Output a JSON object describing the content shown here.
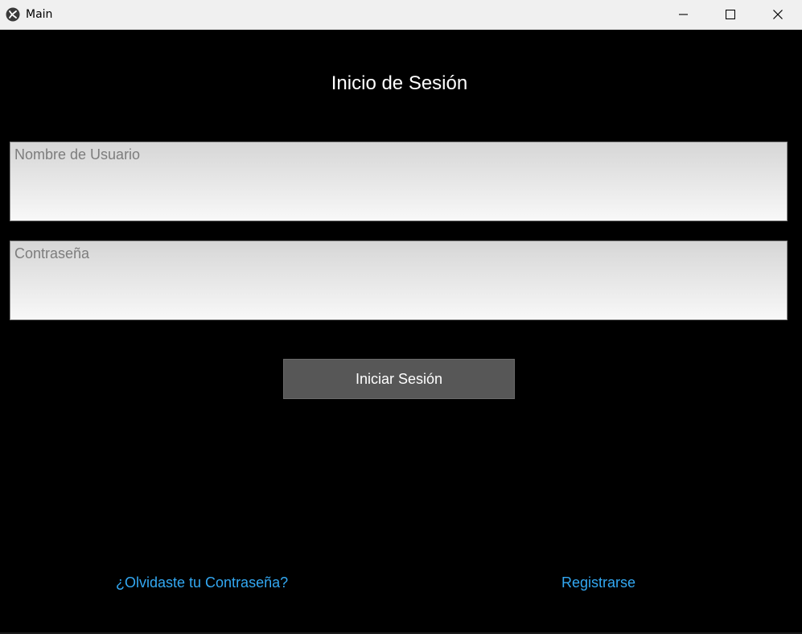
{
  "window": {
    "title": "Main",
    "app_icon": "kivy-logo-icon",
    "controls": {
      "minimize_icon": "minimize-icon",
      "maximize_icon": "maximize-icon",
      "close_icon": "close-icon"
    }
  },
  "login": {
    "title": "Inicio de Sesión",
    "username": {
      "placeholder": "Nombre de Usuario",
      "value": ""
    },
    "password": {
      "placeholder": "Contraseña",
      "value": ""
    },
    "submit_label": "Iniciar Sesión",
    "forgot_password_label": "¿Olvidaste tu Contraseña?",
    "register_label": "Registrarse"
  },
  "colors": {
    "background": "#000000",
    "titlebar": "#f0f0f0",
    "button": "#575757",
    "link": "#33a8f2",
    "title_text": "#ffffff",
    "placeholder_text": "#7d7d7d"
  }
}
